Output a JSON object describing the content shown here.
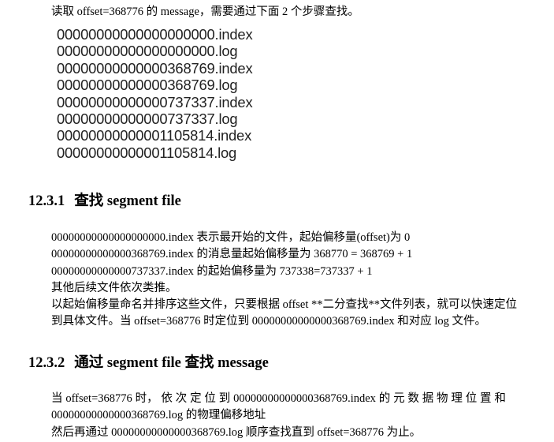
{
  "intro": "读取 offset=368776 的 message，需要通过下面 2 个步骤查找。",
  "files": [
    "00000000000000000000.index",
    "00000000000000000000.log",
    "00000000000000368769.index",
    "00000000000000368769.log",
    "00000000000000737337.index",
    "00000000000000737337.log",
    "00000000000001105814.index",
    "00000000000001105814.log"
  ],
  "section1": {
    "number": "12.3.1",
    "title": "查找 segment file",
    "lines": [
      "00000000000000000000.index 表示最开始的文件，起始偏移量(offset)为 0",
      "00000000000000368769.index 的消息量起始偏移量为 368770 = 368769 + 1",
      "00000000000000737337.index 的起始偏移量为 737338=737337 + 1",
      "其他后续文件依次类推。",
      "以起始偏移量命名并排序这些文件，只要根据 offset **二分查找**文件列表，就可以快速定位",
      "到具体文件。当 offset=368776 时定位到 00000000000000368769.index 和对应 log 文件。"
    ]
  },
  "section2": {
    "number": "12.3.2",
    "title": "通过 segment file 查找 message",
    "line1_words": [
      "当",
      "offset=368776",
      "时，",
      "依",
      "次",
      "定",
      "位",
      "到",
      "00000000000000368769.index",
      "的",
      "元",
      "数",
      "据",
      "物",
      "理",
      "位",
      "置",
      "和"
    ],
    "line2": "00000000000000368769.log 的物理偏移地址",
    "line3": "然后再通过 00000000000000368769.log 顺序查找直到 offset=368776 为止。"
  }
}
